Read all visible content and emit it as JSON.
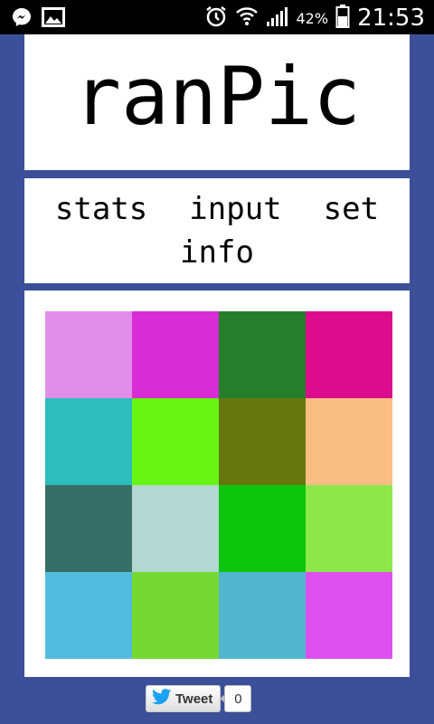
{
  "status_bar": {
    "icons_left": [
      "messenger-icon",
      "image-icon"
    ],
    "icons_right": [
      "alarm-icon",
      "wifi-icon",
      "signal-icon",
      "battery-icon"
    ],
    "battery_percent": "42%",
    "time": "21:53"
  },
  "app": {
    "title": "ranPic",
    "nav": [
      "stats",
      "input",
      "set",
      "info"
    ]
  },
  "grid": {
    "rows": 4,
    "cols": 4,
    "colors": [
      "#e08eea",
      "#d82cd4",
      "#257e2c",
      "#dc0c8c",
      "#2cbdbc",
      "#68f412",
      "#667710",
      "#f8be84",
      "#376f66",
      "#b3d8d2",
      "#0ec50e",
      "#8ee74a",
      "#53bbde",
      "#77d833",
      "#53b6cf",
      "#dd52ef"
    ]
  },
  "tweet": {
    "label": "Tweet",
    "count": "0"
  },
  "colors": {
    "background": "#3b5098",
    "panel": "#ffffff",
    "twitter_blue": "#1da1f2"
  }
}
